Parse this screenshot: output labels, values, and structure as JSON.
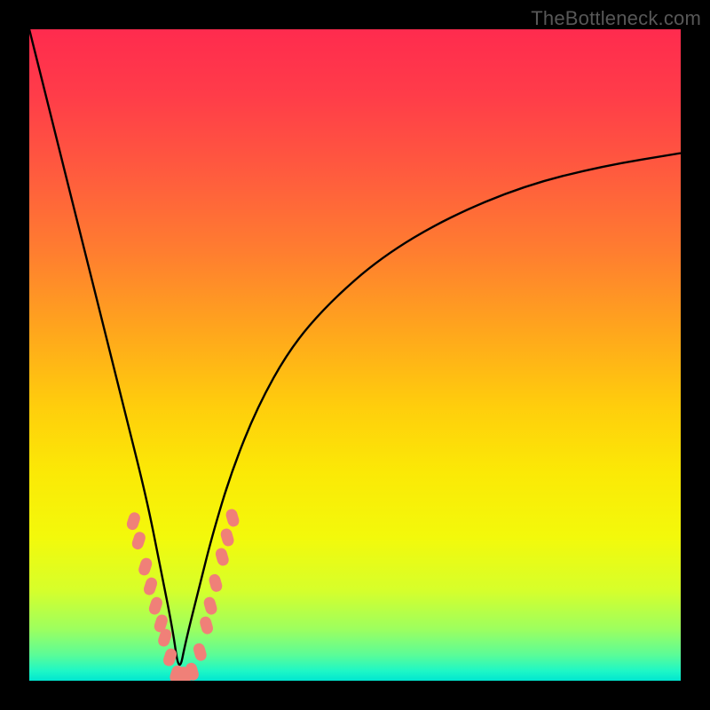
{
  "watermark": "TheBottleneck.com",
  "colors": {
    "background": "#000000",
    "curve_stroke": "#000000",
    "marker_fill": "#f08078",
    "gradient_top": "#ff2b4e",
    "gradient_bottom": "#00e6d0"
  },
  "chart_data": {
    "type": "line",
    "title": "",
    "xlabel": "",
    "ylabel": "",
    "xlim": [
      0,
      100
    ],
    "ylim": [
      0,
      100
    ],
    "note": "Axes unlabeled; values inferred as percentages of plot area. Curve has a sharp V-shaped minimum near x≈23 reaching y≈0, rising steeply to y≈100 at x≈0 and gradually toward y≈80 at x=100.",
    "series": [
      {
        "name": "curve",
        "x": [
          0,
          4,
          8,
          12,
          15,
          18,
          20,
          22,
          23,
          24,
          26,
          28,
          31,
          35,
          40,
          46,
          54,
          64,
          76,
          88,
          100
        ],
        "y": [
          100,
          84,
          68,
          52,
          40,
          28,
          18,
          8,
          1,
          6,
          14,
          22,
          32,
          42,
          51,
          58,
          65,
          71,
          76,
          79,
          81
        ]
      }
    ],
    "markers": {
      "name": "highlighted-points",
      "note": "Pink rounded markers clustered on both branches near the minimum.",
      "points": [
        {
          "x": 16.0,
          "y": 24.5
        },
        {
          "x": 16.8,
          "y": 21.5
        },
        {
          "x": 17.8,
          "y": 17.5
        },
        {
          "x": 18.6,
          "y": 14.5
        },
        {
          "x": 19.4,
          "y": 11.5
        },
        {
          "x": 20.2,
          "y": 8.8
        },
        {
          "x": 20.8,
          "y": 6.6
        },
        {
          "x": 21.6,
          "y": 3.6
        },
        {
          "x": 22.6,
          "y": 1.0
        },
        {
          "x": 23.8,
          "y": 0.8
        },
        {
          "x": 25.0,
          "y": 1.4
        },
        {
          "x": 26.2,
          "y": 4.4
        },
        {
          "x": 27.2,
          "y": 8.5
        },
        {
          "x": 27.8,
          "y": 11.5
        },
        {
          "x": 28.6,
          "y": 15.0
        },
        {
          "x": 29.6,
          "y": 19.0
        },
        {
          "x": 30.4,
          "y": 22.0
        },
        {
          "x": 31.2,
          "y": 25.0
        }
      ]
    }
  }
}
